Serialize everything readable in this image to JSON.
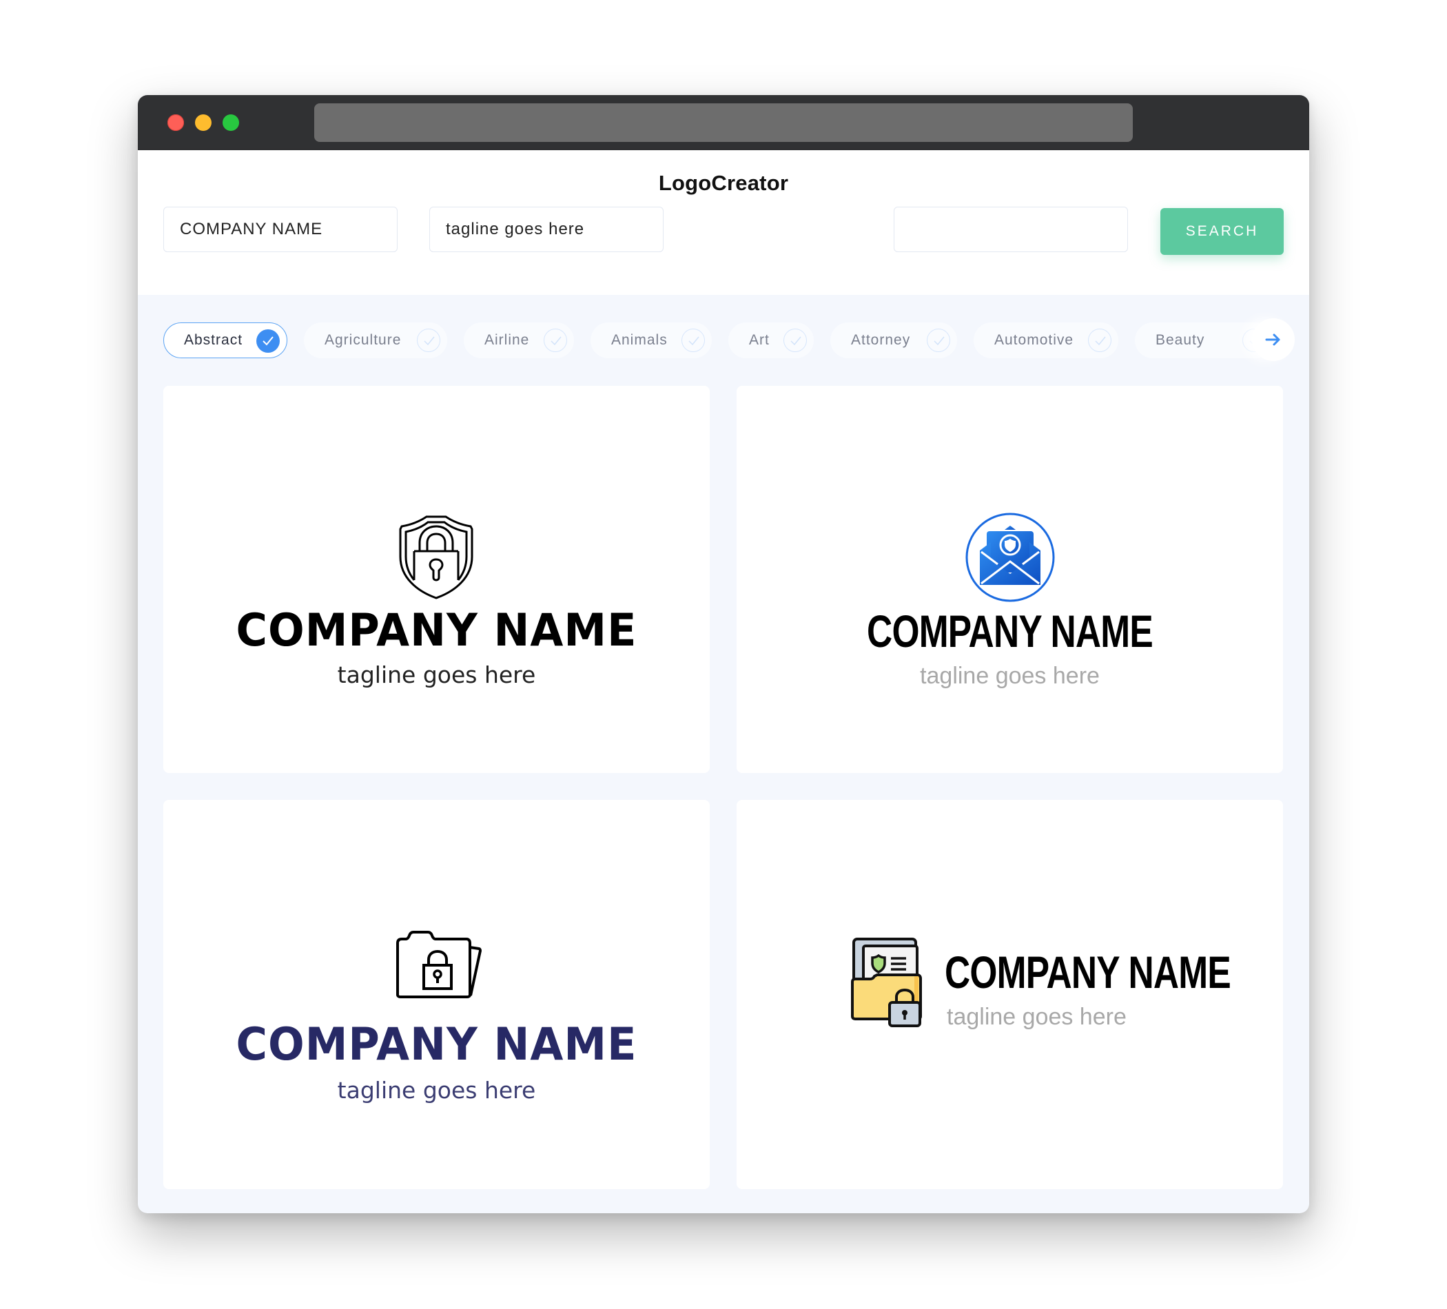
{
  "window": {
    "controls": [
      "close",
      "minimize",
      "maximize"
    ],
    "url": ""
  },
  "header": {
    "title": "LogoCreator"
  },
  "search": {
    "company_name_value": "COMPANY NAME",
    "tagline_value": "tagline goes here",
    "keyword_value": "",
    "button_label": "SEARCH"
  },
  "categories": {
    "items": [
      {
        "label": "Abstract",
        "selected": true
      },
      {
        "label": "Agriculture",
        "selected": false
      },
      {
        "label": "Airline",
        "selected": false
      },
      {
        "label": "Animals",
        "selected": false
      },
      {
        "label": "Art",
        "selected": false
      },
      {
        "label": "Attorney",
        "selected": false
      },
      {
        "label": "Automotive",
        "selected": false
      },
      {
        "label": "Beauty",
        "selected": false
      }
    ],
    "next_icon": "arrow-right-icon"
  },
  "logos": [
    {
      "icon": "shield-padlock-icon",
      "company": "COMPANY NAME",
      "tagline": "tagline goes here",
      "name_color": "#000000",
      "tagline_color": "#222222",
      "layout": "stacked"
    },
    {
      "icon": "secure-envelope-icon",
      "company": "COMPANY NAME",
      "tagline": "tagline goes here",
      "name_color": "#000000",
      "tagline_color": "#a8a8a8",
      "icon_color": "#1560d4",
      "layout": "stacked"
    },
    {
      "icon": "locked-folder-icon",
      "company": "COMPANY NAME",
      "tagline": "tagline goes here",
      "name_color": "#272965",
      "tagline_color": "#3b3d72",
      "layout": "stacked"
    },
    {
      "icon": "secure-document-folder-icon",
      "company": "COMPANY NAME",
      "tagline": "tagline goes here",
      "name_color": "#000000",
      "tagline_color": "#a8a8a8",
      "layout": "inline"
    }
  ],
  "colors": {
    "accent_blue": "#3d8ef2",
    "search_green": "#5cc99f",
    "page_bg": "#f4f7fd",
    "titlebar": "#303133"
  }
}
